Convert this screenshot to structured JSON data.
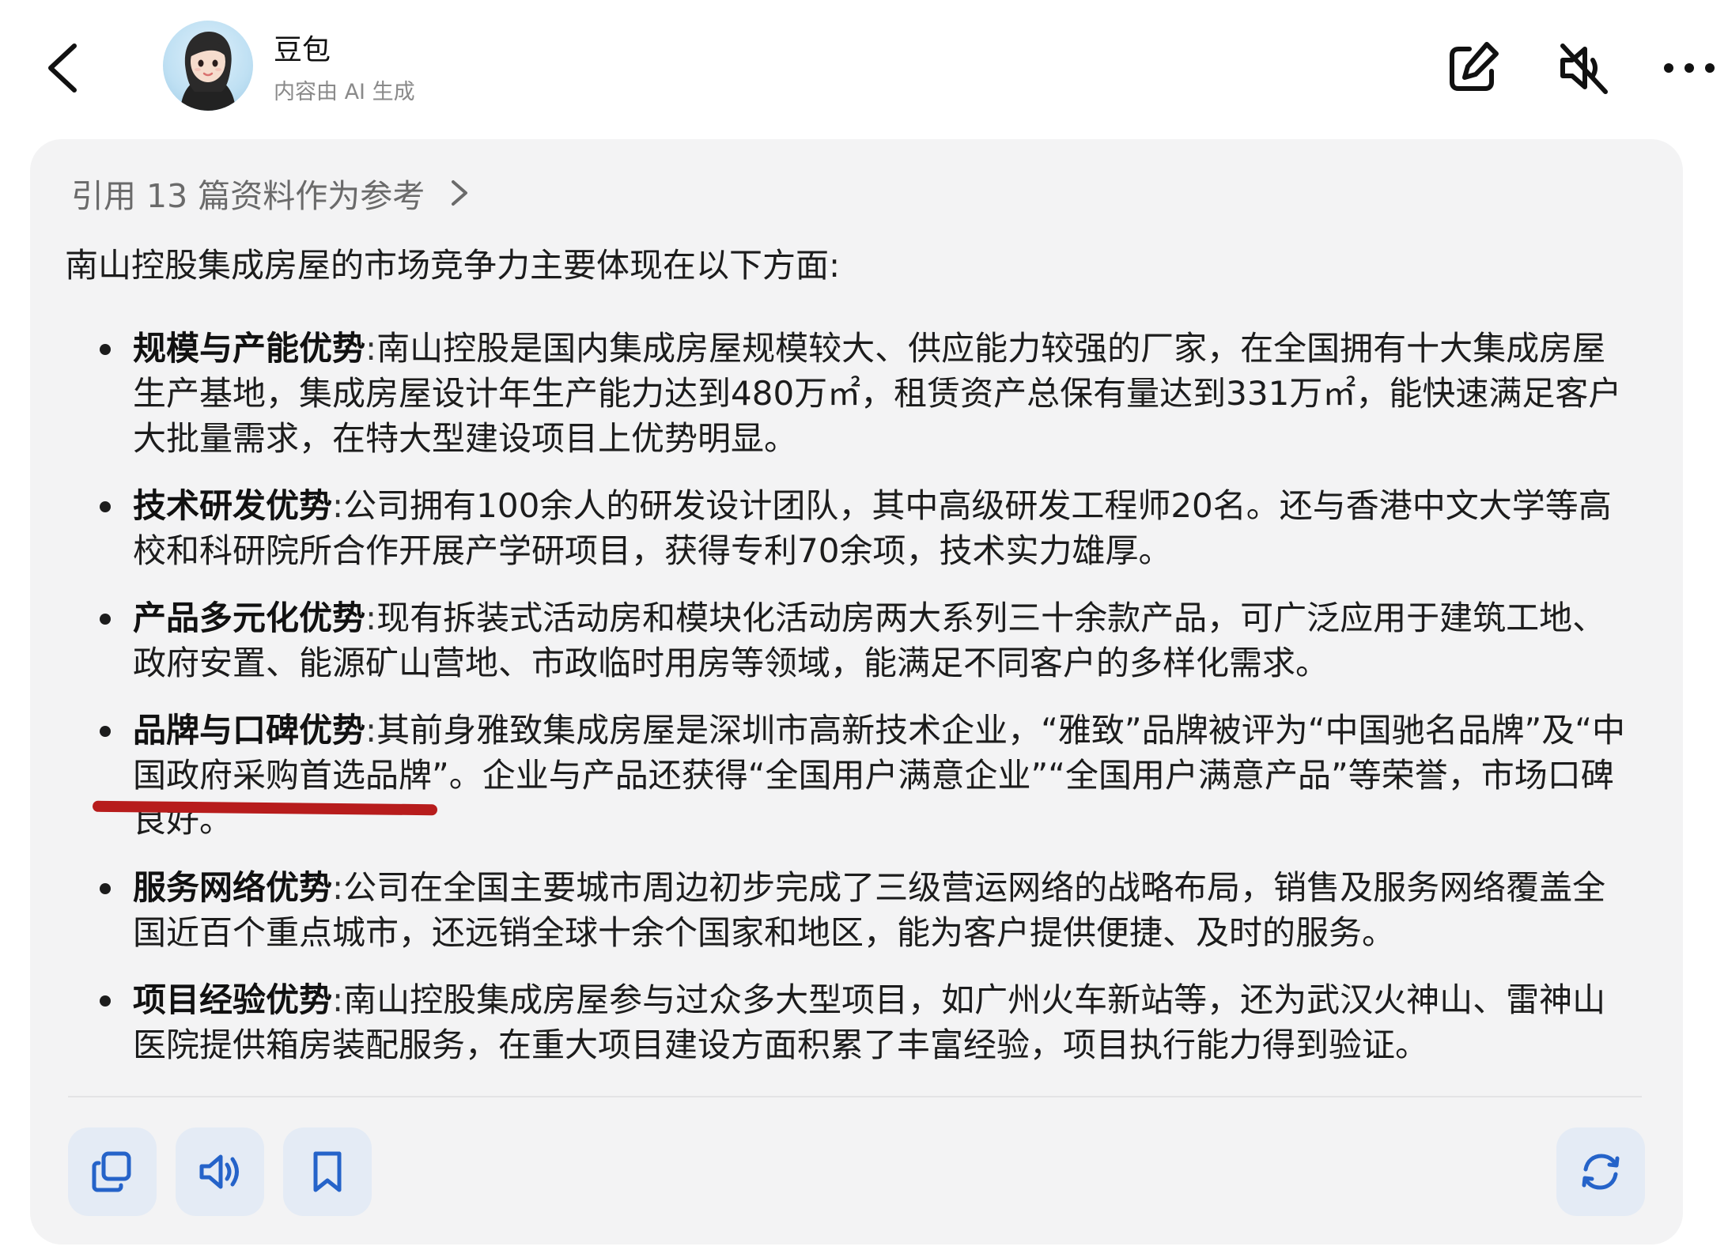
{
  "header": {
    "bot_name": "豆包",
    "subtitle": "内容由 AI 生成",
    "icons": [
      "back-icon",
      "edit-icon",
      "mute-icon",
      "more-icon"
    ]
  },
  "card": {
    "references_label": "引用 13 篇资料作为参考",
    "intro": "南山控股集成房屋的市场竞争力主要体现在以下方面:",
    "points": [
      {
        "title": "规模与产能优势",
        "body": "南山控股是国内集成房屋规模较大、供应能力较强的厂家，在全国拥有十大集成房屋生产基地，集成房屋设计年生产能力达到480万㎡，租赁资产总保有量达到331万㎡，能快速满足客户大批量需求，在特大型建设项目上优势明显。"
      },
      {
        "title": "技术研发优势",
        "body": "公司拥有100余人的研发设计团队，其中高级研发工程师20名。还与香港中文大学等高校和科研院所合作开展产学研项目，获得专利70余项，技术实力雄厚。"
      },
      {
        "title": "产品多元化优势",
        "body": "现有拆装式活动房和模块化活动房两大系列三十余款产品，可广泛应用于建筑工地、政府安置、能源矿山营地、市政临时用房等领域，能满足不同客户的多样化需求。"
      },
      {
        "title": "品牌与口碑优势",
        "body": "其前身雅致集成房屋是深圳市高新技术企业，“雅致”品牌被评为“中国驰名品牌”及“中国政府采购首选品牌”。企业与产品还获得“全国用户满意企业”“全国用户满意产品”等荣誉，市场口碑良好。"
      },
      {
        "title": "服务网络优势",
        "body": "公司在全国主要城市周边初步完成了三级营运网络的战略布局，销售及服务网络覆盖全国近百个重点城市，还远销全球十余个国家和地区，能为客户提供便捷、及时的服务。"
      },
      {
        "title": "项目经验优势",
        "body": "南山控股集成房屋参与过众多大型项目，如广州火车新站等，还为武汉火神山、雷神山医院提供箱房装配服务，在重大项目建设方面积累了丰富经验，项目执行能力得到验证。"
      }
    ],
    "separator": ":",
    "actions": [
      "copy-icon",
      "speaker-icon",
      "bookmark-icon",
      "regenerate-icon"
    ],
    "accent_color": "#2563c9",
    "annotation_color": "#b71c1c"
  }
}
